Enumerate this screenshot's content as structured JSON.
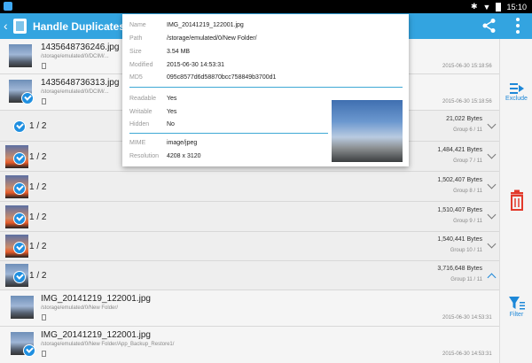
{
  "statusbar": {
    "time": "15:10"
  },
  "actionbar": {
    "title": "Handle Duplicates"
  },
  "sidebar": {
    "exclude_label": "Exclude",
    "filter_label": "Filter"
  },
  "colors": {
    "accent": "#33a4e0",
    "check": "#1f8fe0",
    "delete": "#e23a2b"
  },
  "files_top": [
    {
      "name": "1435648736246.jpg",
      "path": "/storage/emulated/0/DCIM/...",
      "date": "2015-06-30 15:18:56"
    },
    {
      "name": "1435648736313.jpg",
      "path": "/storage/emulated/0/DCIM/...",
      "date": "2015-06-30 15:18:56"
    }
  ],
  "groups": [
    {
      "count": "1 / 2",
      "size": "21,022 Bytes",
      "label": "Group 6 / 11"
    },
    {
      "count": "1 / 2",
      "size": "1,484,421 Bytes",
      "label": "Group 7 / 11"
    },
    {
      "count": "1 / 2",
      "size": "1,502,407 Bytes",
      "label": "Group 8 / 11"
    },
    {
      "count": "1 / 2",
      "size": "1,510,407 Bytes",
      "label": "Group 9 / 11"
    },
    {
      "count": "1 / 2",
      "size": "1,540,441 Bytes",
      "label": "Group 10 / 11"
    },
    {
      "count": "1 / 2",
      "size": "3,716,648 Bytes",
      "label": "Group 11 / 11"
    }
  ],
  "files_bottom": [
    {
      "name": "IMG_20141219_122001.jpg",
      "path": "/storage/emulated/0/New Folder/",
      "date": "2015-06-30 14:53:31"
    },
    {
      "name": "IMG_20141219_122001.jpg",
      "path": "/storage/emulated/0/New Folder/App_Backup_Restore1/",
      "date": "2015-06-30 14:53:31"
    }
  ],
  "details": {
    "name_label": "Name",
    "name": "IMG_20141219_122001.jpg",
    "path_label": "Path",
    "path": "/storage/emulated/0/New Folder/",
    "size_label": "Size",
    "size": "3.54 MB",
    "modified_label": "Modified",
    "modified": "2015-06-30 14:53:31",
    "md5_label": "MD5",
    "md5": "095c8577d6d58870bcc758849b3700d1",
    "readable_label": "Readable",
    "readable": "Yes",
    "writable_label": "Writable",
    "writable": "Yes",
    "hidden_label": "Hidden",
    "hidden": "No",
    "mime_label": "MIME",
    "mime": "image/jpeg",
    "resolution_label": "Resolution",
    "resolution": "4208 x 3120"
  }
}
